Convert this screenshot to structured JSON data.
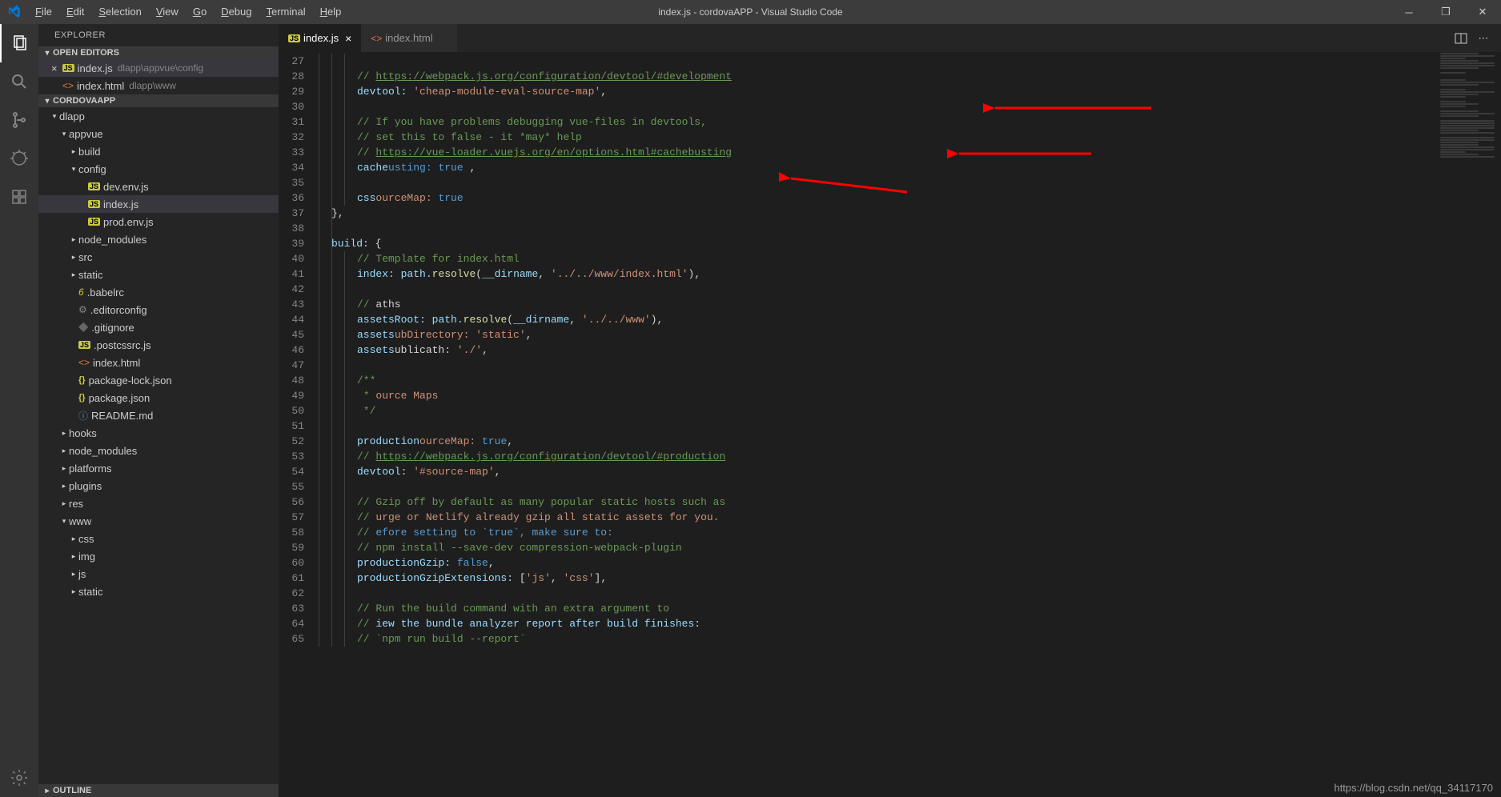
{
  "title": "index.js - cordovaAPP - Visual Studio Code",
  "menu": [
    "File",
    "Edit",
    "Selection",
    "View",
    "Go",
    "Debug",
    "Terminal",
    "Help"
  ],
  "sidebar_title": "EXPLORER",
  "sections": {
    "open_editors": "OPEN EDITORS",
    "project": "CORDOVAAPP",
    "outline": "OUTLINE"
  },
  "open_editors": [
    {
      "name": "index.js",
      "path": "dlapp\\appvue\\config",
      "type": "js",
      "active": true,
      "unsaved": true
    },
    {
      "name": "index.html",
      "path": "dlapp\\www",
      "type": "html"
    }
  ],
  "tree": [
    {
      "name": "dlapp",
      "depth": 0,
      "type": "folder",
      "expanded": true
    },
    {
      "name": "appvue",
      "depth": 1,
      "type": "folder",
      "expanded": true
    },
    {
      "name": "build",
      "depth": 2,
      "type": "folder"
    },
    {
      "name": "config",
      "depth": 2,
      "type": "folder",
      "expanded": true
    },
    {
      "name": "dev.env.js",
      "depth": 3,
      "type": "js"
    },
    {
      "name": "index.js",
      "depth": 3,
      "type": "js",
      "active": true
    },
    {
      "name": "prod.env.js",
      "depth": 3,
      "type": "js"
    },
    {
      "name": "node_modules",
      "depth": 2,
      "type": "folder"
    },
    {
      "name": "src",
      "depth": 2,
      "type": "folder"
    },
    {
      "name": "static",
      "depth": 2,
      "type": "folder"
    },
    {
      "name": ".babelrc",
      "depth": 2,
      "type": "six"
    },
    {
      "name": ".editorconfig",
      "depth": 2,
      "type": "gear"
    },
    {
      "name": ".gitignore",
      "depth": 2,
      "type": "dot"
    },
    {
      "name": ".postcssrc.js",
      "depth": 2,
      "type": "js"
    },
    {
      "name": "index.html",
      "depth": 2,
      "type": "html"
    },
    {
      "name": "package-lock.json",
      "depth": 2,
      "type": "json"
    },
    {
      "name": "package.json",
      "depth": 2,
      "type": "json"
    },
    {
      "name": "README.md",
      "depth": 2,
      "type": "info"
    },
    {
      "name": "hooks",
      "depth": 1,
      "type": "folder"
    },
    {
      "name": "node_modules",
      "depth": 1,
      "type": "folder"
    },
    {
      "name": "platforms",
      "depth": 1,
      "type": "folder"
    },
    {
      "name": "plugins",
      "depth": 1,
      "type": "folder"
    },
    {
      "name": "res",
      "depth": 1,
      "type": "folder"
    },
    {
      "name": "www",
      "depth": 1,
      "type": "folder",
      "expanded": true
    },
    {
      "name": "css",
      "depth": 2,
      "type": "folder"
    },
    {
      "name": "img",
      "depth": 2,
      "type": "folder"
    },
    {
      "name": "js",
      "depth": 2,
      "type": "folder"
    },
    {
      "name": "static",
      "depth": 2,
      "type": "folder"
    }
  ],
  "tabs": [
    {
      "name": "index.js",
      "type": "js",
      "active": true
    },
    {
      "name": "index.html",
      "type": "html"
    }
  ],
  "line_start": 27,
  "line_end": 65,
  "code_lines": [
    "",
    "C// https://webpack.js.org/configuration/devtool/#development|L",
    "Kdevtool:P S'cheap-module-eval-source-map'P,",
    "",
    "C// If you have problems debugging vue-files in devtools,",
    "C// set this to false - it *may* help",
    "C// https://vue-loader.vuejs.org/en/options.html#cachebusting|L",
    "KcacheBusting:P Btrue P,",
    "",
    "KcssSourceMap:P Btrue",
    "P},",
    "",
    "Kbuild:P P{",
    "C// Template for index.html",
    "Kindex:P Vpath.FresolveP(V__dirnameP, S'../../www/index.html'P),",
    "",
    "C// Paths",
    "KassetsRoot:P Vpath.FresolveP(V__dirnameP, S'../../www'P),",
    "KassetsSubDirectory:P S'static'P,",
    "KassetsPublicPath:P S'./'P,",
    "",
    "C/**",
    "C * Source Maps",
    "C */",
    "",
    "KproductionSourceMap:P BtrueP,",
    "C// https://webpack.js.org/configuration/devtool/#production|L",
    "Kdevtool:P S'#source-map'P,",
    "",
    "C// Gzip off by default as many popular static hosts such as",
    "C// Surge or Netlify already gzip all static assets for you.",
    "C// Before setting to `true`, make sure to:",
    "C// npm install --save-dev compression-webpack-plugin",
    "KproductionGzip:P BfalseP,",
    "KproductionGzipExtensions:P P[S'js'P, S'css'P],",
    "",
    "C// Run the build command with an extra argument to",
    "C// View the bundle analyzer report after build finishes:",
    "C// `npm run build --report`"
  ],
  "indent_levels": [
    3,
    3,
    3,
    3,
    3,
    3,
    3,
    3,
    3,
    3,
    2,
    2,
    2,
    3,
    3,
    3,
    3,
    3,
    3,
    3,
    3,
    3,
    3,
    3,
    3,
    3,
    3,
    3,
    3,
    3,
    3,
    3,
    3,
    3,
    3,
    3,
    3,
    3,
    3
  ],
  "footer_url": "https://blog.csdn.net/qq_34117170"
}
